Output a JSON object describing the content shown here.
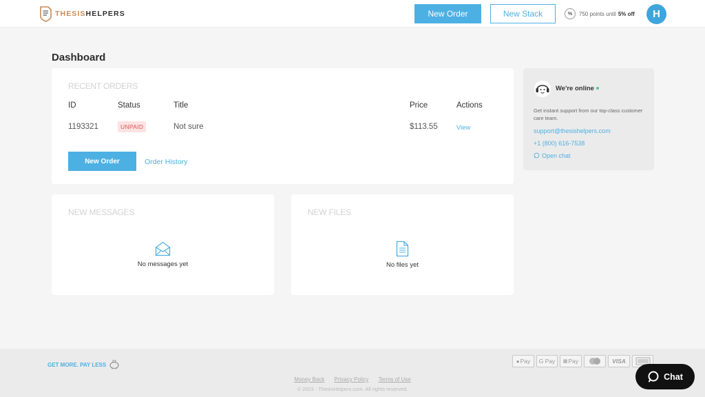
{
  "header": {
    "logo_part1": "THESIS",
    "logo_part2": "HELPERS",
    "new_order_label": "New Order",
    "new_stack_label": "New Stack",
    "points_icon": "%",
    "points_text": "750 points until",
    "points_discount": "5% off",
    "avatar_initial": "H"
  },
  "dashboard": {
    "title": "Dashboard"
  },
  "recent_orders": {
    "title": "RECENT ORDERS",
    "columns": [
      "ID",
      "Status",
      "Title",
      "Price",
      "Actions"
    ],
    "rows": [
      {
        "id": "1193321",
        "status": "UNPAID",
        "title": "Not sure",
        "price": "$113.55",
        "action": "View"
      }
    ],
    "new_order_label": "New Order",
    "history_label": "Order History"
  },
  "support": {
    "status": "We're online",
    "description": "Get instant support from our top-class customer care team.",
    "email": "support@thesishelpers.com",
    "phone": "+1 (800) 616-7538",
    "chat_label": "Open chat"
  },
  "messages": {
    "title": "NEW MESSAGES",
    "empty": "No messages yet"
  },
  "files": {
    "title": "NEW FILES",
    "empty": "No files yet"
  },
  "footer": {
    "promo": "GET MORE. PAY LESS",
    "payments": [
      "Apple Pay",
      "G Pay",
      "Pay",
      "Mastercard",
      "VISA",
      "Amex"
    ],
    "payment_labels": {
      "apple": "Pay",
      "google": "G Pay",
      "generic": "Pay",
      "visa": "VISA"
    },
    "links": [
      "Money Back",
      "Privacy Policy",
      "Terms of Use"
    ],
    "copyright": "© 2023 · ThesisHelpers.com. All rights reserved."
  },
  "chat": {
    "label": "Chat"
  },
  "colors": {
    "accent": "#4db0e3",
    "unpaid": "#e05252",
    "online": "#55c98a"
  }
}
